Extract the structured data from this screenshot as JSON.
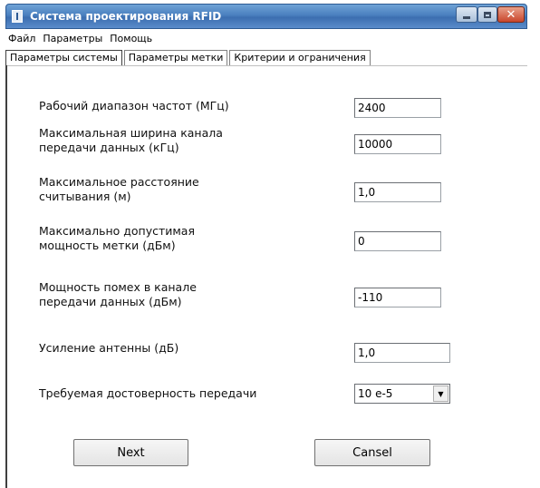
{
  "window": {
    "title": "Система проектирования RFID"
  },
  "menu": [
    "Файл",
    "Параметры",
    "Помощь"
  ],
  "tabs": [
    "Параметры системы",
    "Параметры метки",
    "Критерии и ограничения"
  ],
  "fields": [
    {
      "label": "Рабочий диапазон частот (МГц)",
      "value": "2400"
    },
    {
      "label": "Максимальная  ширина канала\nпередачи данных (кГц)",
      "value": "10000"
    },
    {
      "label": "Максимальное расстояние\nсчитывания (м)",
      "value": "1,0"
    },
    {
      "label": "Максимально допустимая\nмощность метки (дБм)",
      "value": "0"
    },
    {
      "label": "Мощность помех в канале\nпередачи данных  (дБм)",
      "value": "-110"
    },
    {
      "label": "Усиление антенны (дБ)",
      "value": "1,0"
    },
    {
      "label": "Требуемая достоверность передачи",
      "value": "10 e-5"
    }
  ],
  "buttons": {
    "next": "Next",
    "cancel": "Cansel"
  }
}
